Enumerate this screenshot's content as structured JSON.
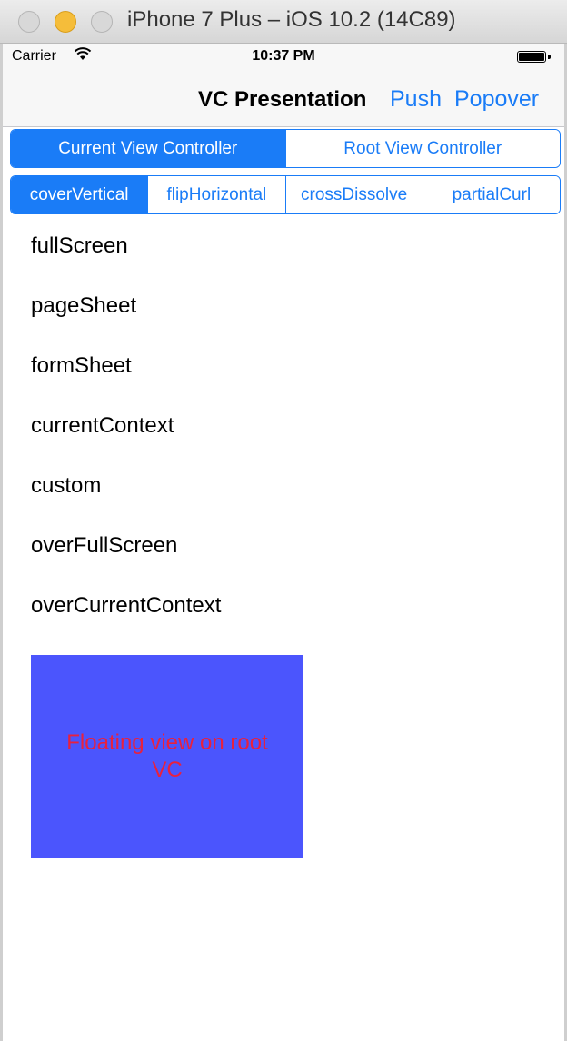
{
  "window": {
    "title": "iPhone 7 Plus – iOS 10.2 (14C89)"
  },
  "status_bar": {
    "carrier": "Carrier",
    "wifi_icon": "wifi-icon",
    "time": "10:37 PM",
    "battery_icon": "battery-icon"
  },
  "nav_bar": {
    "title": "VC Presentation",
    "push_label": "Push",
    "popover_label": "Popover"
  },
  "context_segment": {
    "items": [
      "Current View Controller",
      "Root View Controller"
    ],
    "selected_index": 0
  },
  "transition_segment": {
    "items": [
      "coverVertical",
      "flipHorizontal",
      "crossDissolve",
      "partialCurl"
    ],
    "selected_index": 0
  },
  "presentation_styles": [
    "fullScreen",
    "pageSheet",
    "formSheet",
    "currentContext",
    "custom",
    "overFullScreen",
    "overCurrentContext"
  ],
  "floating_view": {
    "label": "Floating view on root VC"
  },
  "colors": {
    "tint": "#1a7cf7",
    "floating_bg": "#4b55fd",
    "floating_text": "#e8213e"
  }
}
